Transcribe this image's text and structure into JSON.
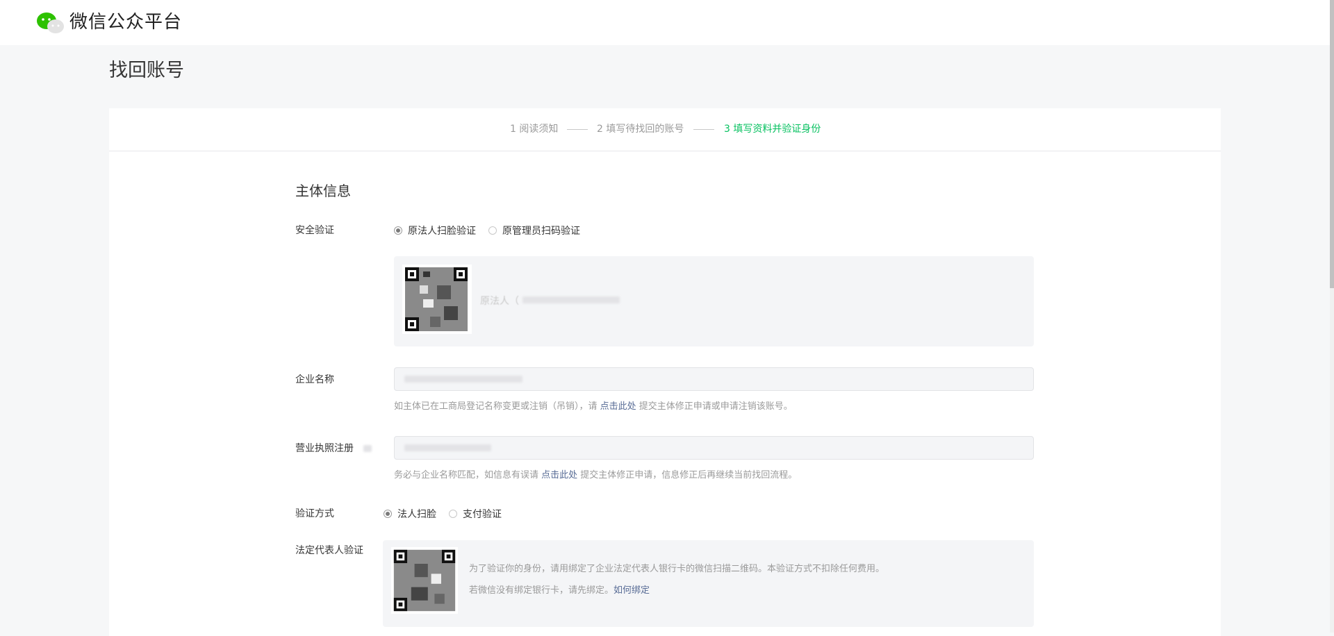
{
  "brand": {
    "name": "微信公众平台",
    "logo_icon": "wechat-logo-icon"
  },
  "page": {
    "title": "找回账号"
  },
  "steps": [
    {
      "label": "1 阅读须知",
      "active": false
    },
    {
      "label": "2 填写待找回的账号",
      "active": false
    },
    {
      "label": "3 填写资料并验证身份",
      "active": true
    }
  ],
  "section": {
    "title": "主体信息"
  },
  "security": {
    "label": "安全验证",
    "options": [
      "原法人扫脸验证",
      "原管理员扫码验证"
    ],
    "selected": "原法人扫脸验证",
    "qr_caption": "原法人（"
  },
  "company": {
    "label": "企业名称",
    "hint_before": "如主体已在工商局登记名称变更或注销（吊销），请 ",
    "hint_link": "点击此处",
    "hint_after": " 提交主体修正申请或申请注销该账号。"
  },
  "license": {
    "label": "营业执照注册",
    "hint_before": "务必与企业名称匹配，如信息有误请 ",
    "hint_link": "点击此处",
    "hint_after": " 提交主体修正申请，信息修正后再继续当前找回流程。"
  },
  "verify_method": {
    "label": "验证方式",
    "options": [
      "法人扫脸",
      "支付验证"
    ],
    "selected": "法人扫脸"
  },
  "legal_rep": {
    "label": "法定代表人验证",
    "line1": "为了验证你的身份，请用绑定了企业法定代表人银行卡的微信扫描二维码。本验证方式不扣除任何费用。",
    "line2_before": "若微信没有绑定银行卡，请先绑定。",
    "line2_link": "如何绑定"
  },
  "colors": {
    "accent": "#07c160",
    "link": "#576b95",
    "muted": "#9a9a9a"
  }
}
